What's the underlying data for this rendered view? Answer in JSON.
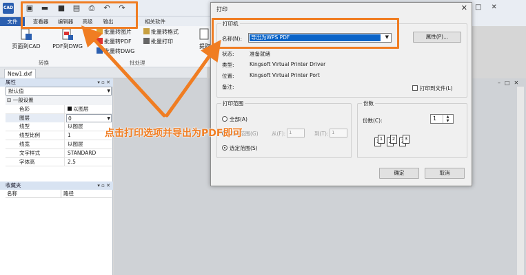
{
  "app": {
    "logo_text": "CAD",
    "quick_access_icons": [
      "save-icon",
      "folder-icon",
      "save-as-icon",
      "pdf-export-icon",
      "print-icon",
      "undo-icon",
      "redo-icon"
    ]
  },
  "ribbon": {
    "tabs": [
      "文件",
      "查看器",
      "编辑器",
      "高级",
      "输出",
      "相关软件"
    ],
    "big_buttons": [
      {
        "label": "页面到CAD",
        "icon": "page-to-cad-icon"
      },
      {
        "label": "PDF到DWG",
        "icon": "pdf-to-dwg-icon"
      },
      {
        "label": "提取",
        "icon": "extract-icon"
      }
    ],
    "small_buttons": [
      {
        "label": "批量转图片"
      },
      {
        "label": "批量转格式"
      },
      {
        "label": "批量转PDF"
      },
      {
        "label": "批量打印"
      },
      {
        "label": "批量转DWG"
      }
    ],
    "groups": [
      "转换",
      "批处理"
    ]
  },
  "document_tab": "New1.dxf",
  "properties": {
    "title": "属性",
    "selector_value": "默认值",
    "rows": [
      {
        "key": "一般设置",
        "value": ""
      },
      {
        "key": "色彩",
        "value": "以图层"
      },
      {
        "key": "图层",
        "value": "0"
      },
      {
        "key": "线型",
        "value": "以图层"
      },
      {
        "key": "线型比例",
        "value": "1"
      },
      {
        "key": "线宽",
        "value": "以图层"
      },
      {
        "key": "文字样式",
        "value": "STANDARD"
      },
      {
        "key": "字体高",
        "value": "2.5"
      }
    ]
  },
  "favorites": {
    "title": "收藏夹",
    "columns": [
      "名称",
      "路径"
    ]
  },
  "dialog": {
    "title": "打印",
    "printer_group": "打印机",
    "name_label": "名称(N):",
    "printer_name": "导出为WPS PDF",
    "properties_button": "属性(P)...",
    "status_label": "状态:",
    "status_value": "准备就绪",
    "type_label": "类型:",
    "type_value": "Kingsoft Virtual Printer Driver",
    "location_label": "位置:",
    "location_value": "Kingsoft Virtual Printer Port",
    "comment_label": "备注:",
    "print_to_file": "打印到文件(L)",
    "range_group": "打印范围",
    "range_all": "全部(A)",
    "range_pages": "页码范围(G)",
    "range_from": "从(F):",
    "range_from_value": "1",
    "range_to": "到(T):",
    "range_to_value": "1",
    "range_selection": "选定范围(S)",
    "copies_group": "份数",
    "copies_label": "份数(C):",
    "copies_value": "1",
    "ok": "确定",
    "cancel": "取消"
  },
  "annotation": {
    "text": "点击打印选项并导出为PDF即可",
    "color": "#f07d22"
  }
}
